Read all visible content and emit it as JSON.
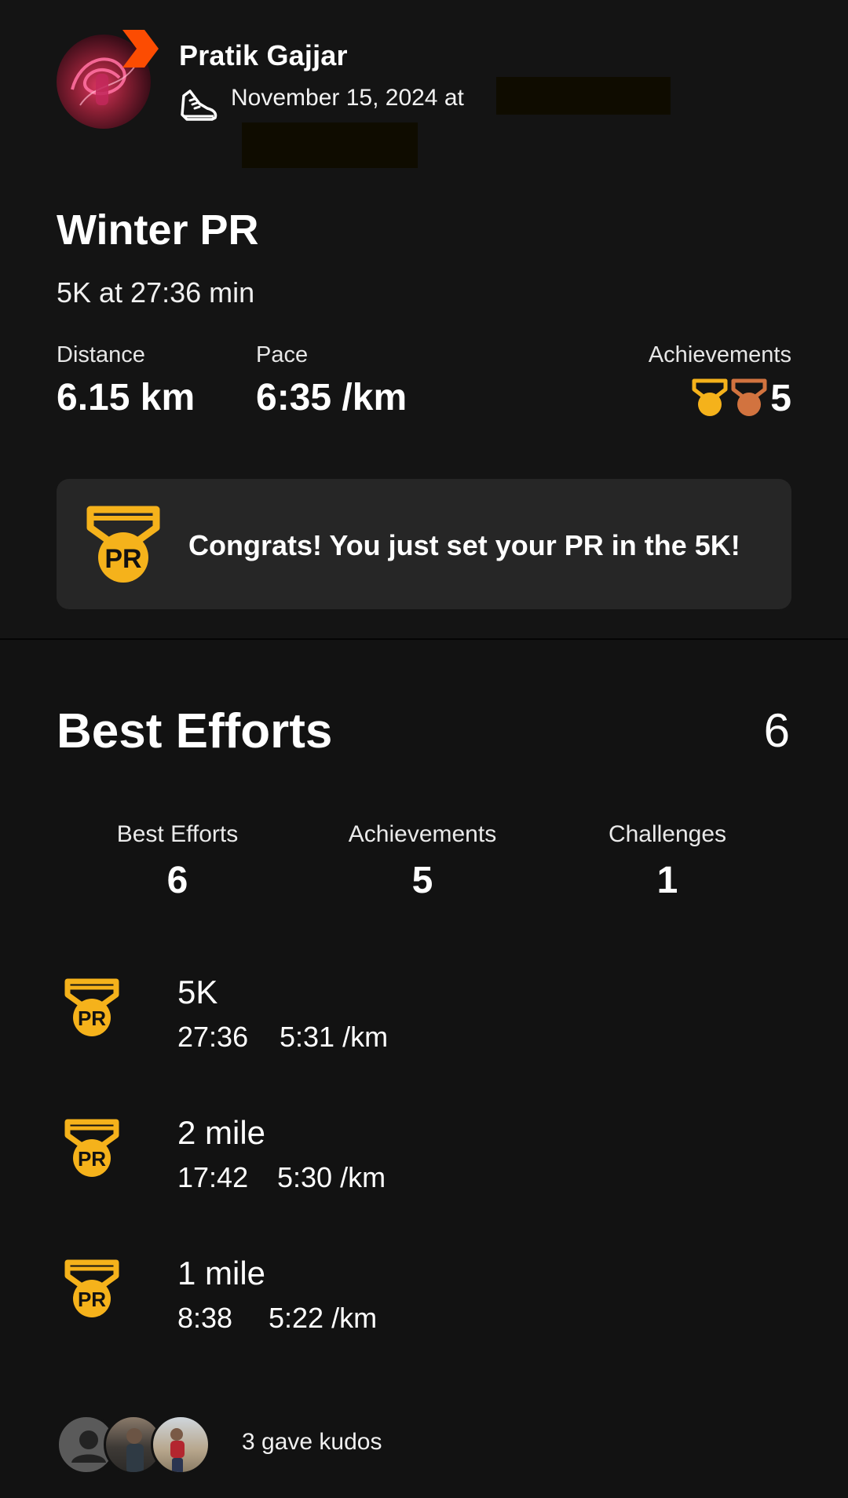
{
  "athlete": {
    "name": "Pratik Gajjar",
    "date_line": "November 15, 2024 at"
  },
  "activity": {
    "title": "Winter PR",
    "description": "5K at 27:36 min",
    "stats": {
      "distance_label": "Distance",
      "distance_value": "6.15 km",
      "pace_label": "Pace",
      "pace_value": "6:35 /km",
      "achievements_label": "Achievements",
      "achievements_value": "5"
    },
    "pr_banner": {
      "icon": "pr-medal-icon",
      "message": "Congrats! You just set your PR in the 5K!"
    }
  },
  "best_efforts": {
    "title": "Best Efforts",
    "count": "6",
    "summary": [
      {
        "label": "Best Efforts",
        "value": "6"
      },
      {
        "label": "Achievements",
        "value": "5"
      },
      {
        "label": "Challenges",
        "value": "1"
      }
    ],
    "items": [
      {
        "name": "5K",
        "time": "27:36",
        "pace": "5:31 /km"
      },
      {
        "name": "2 mile",
        "time": "17:42",
        "pace": "5:30 /km"
      },
      {
        "name": "1 mile",
        "time": "8:38",
        "pace": "5:22 /km"
      }
    ]
  },
  "kudos": {
    "text": "3 gave kudos"
  },
  "colors": {
    "background": "#121212",
    "card": "#262626",
    "gold": "#F5B21B",
    "bronze": "#D2733F",
    "strava_orange": "#FC4C02"
  }
}
